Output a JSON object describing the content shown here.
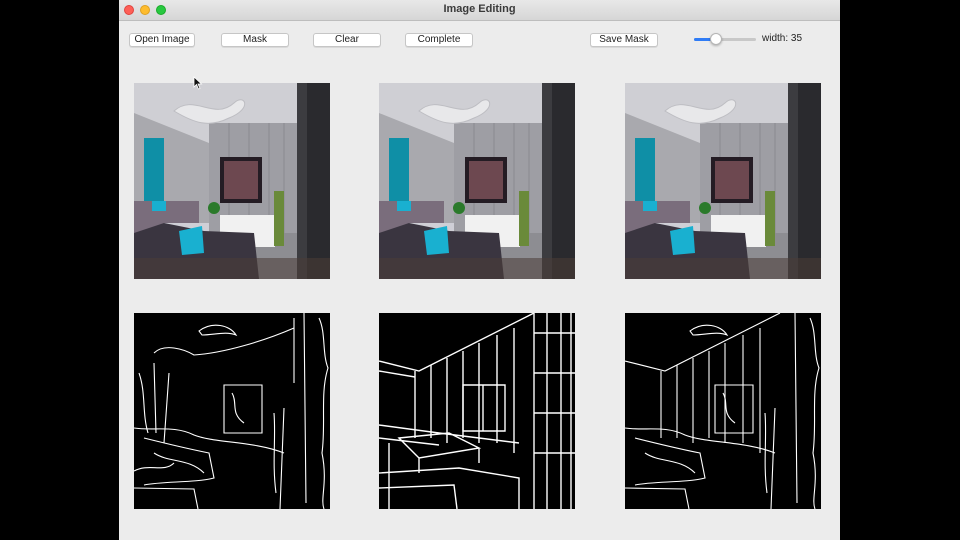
{
  "window": {
    "title": "Image Editing"
  },
  "toolbar": {
    "open_label": "Open Image",
    "mask_label": "Mask",
    "clear_label": "Clear",
    "complete_label": "Complete",
    "save_mask_label": "Save Mask",
    "width_label": "width: 35",
    "slider_value": 35,
    "slider_max": 100
  },
  "colors": {
    "accent": "#2f7cf6",
    "curtain": "#0f8fa6",
    "pillow": "#19b0d0",
    "sofa": "#3a3540",
    "background": "#ececec"
  },
  "panels": {
    "photos": [
      "original-photo",
      "masked-photo",
      "completed-photo"
    ],
    "edges": [
      "original-edge-map",
      "masked-edge-map",
      "completed-edge-map"
    ]
  }
}
